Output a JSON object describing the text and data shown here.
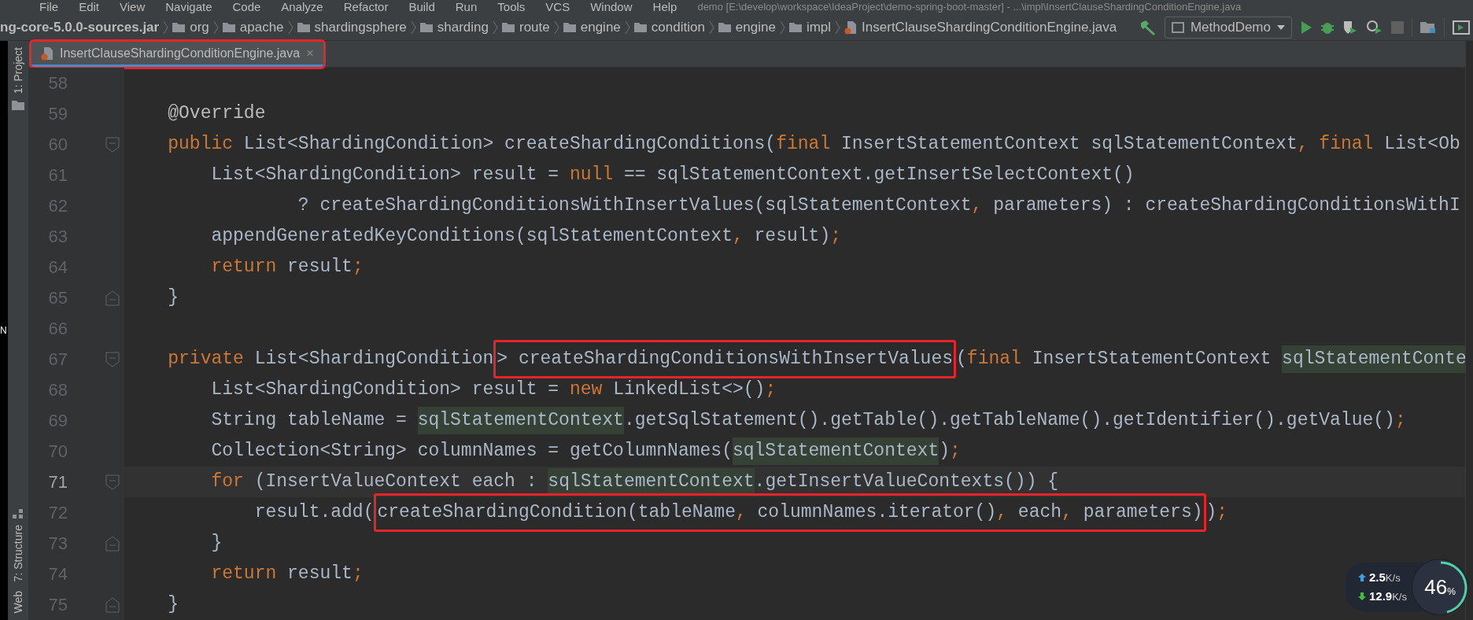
{
  "menu": [
    "File",
    "Edit",
    "View",
    "Navigate",
    "Code",
    "Analyze",
    "Refactor",
    "Build",
    "Run",
    "Tools",
    "VCS",
    "Window",
    "Help"
  ],
  "window": {
    "title": "demo [E:\\develop\\workspace\\IdeaProject\\demo-spring-boot-master] - ...\\impl\\InsertClauseShardingConditionEngine.java"
  },
  "breadcrumbs": [
    {
      "kind": "jar",
      "label": "ng-core-5.0.0-sources.jar"
    },
    {
      "kind": "folder",
      "label": "org"
    },
    {
      "kind": "folder",
      "label": "apache"
    },
    {
      "kind": "folder",
      "label": "shardingsphere"
    },
    {
      "kind": "folder",
      "label": "sharding"
    },
    {
      "kind": "folder",
      "label": "route"
    },
    {
      "kind": "folder",
      "label": "engine"
    },
    {
      "kind": "folder",
      "label": "condition"
    },
    {
      "kind": "folder",
      "label": "engine"
    },
    {
      "kind": "folder",
      "label": "impl"
    },
    {
      "kind": "file",
      "label": "InsertClauseShardingConditionEngine.java"
    }
  ],
  "run_config": "MethodDemo",
  "tabs": [
    {
      "label": "InsertClauseShardingConditionEngine.java",
      "close": "×",
      "selected": true,
      "marked": true
    }
  ],
  "side_panels": [
    {
      "kind": "top",
      "label": "1: Project"
    },
    {
      "kind": "bottom",
      "label": "7: Structure"
    },
    {
      "kind": "bottom",
      "label": "Web"
    }
  ],
  "edge_letter": "N",
  "lines": [
    {
      "number": "58",
      "current": false,
      "fold_start": false,
      "fold_end": false
    },
    {
      "number": "59",
      "current": false,
      "fold_start": false,
      "fold_end": false,
      "tokens": [
        {
          "text": "    @Override",
          "kind": "annotation"
        }
      ]
    },
    {
      "number": "60",
      "current": false,
      "fold_start": true,
      "fold_end": false,
      "tokens": [
        {
          "text": "    public",
          "kind": "keyword"
        },
        {
          "text": " List<ShardingCondition> createShardingConditions(",
          "kind": "plain"
        },
        {
          "text": "final",
          "kind": "keyword"
        },
        {
          "text": " InsertStatementContext sqlStatementContext",
          "kind": "plain"
        },
        {
          "text": ",",
          "kind": "keyword"
        },
        {
          "text": " final",
          "kind": "keyword"
        },
        {
          "text": " List<Ob",
          "kind": "plain"
        }
      ]
    },
    {
      "number": "61",
      "current": false,
      "fold_start": false,
      "fold_end": false,
      "tokens": [
        {
          "text": "        List<ShardingCondition> result = ",
          "kind": "plain"
        },
        {
          "text": "null",
          "kind": "keyword"
        },
        {
          "text": " == sqlStatementContext.getInsertSelectContext()",
          "kind": "plain"
        }
      ]
    },
    {
      "number": "62",
      "current": false,
      "fold_start": false,
      "fold_end": false,
      "tokens": [
        {
          "text": "                ? createShardingConditionsWithInsertValues(sqlStatementContext",
          "kind": "plain"
        },
        {
          "text": ",",
          "kind": "keyword"
        },
        {
          "text": " parameters) : createShardingConditionsWithI",
          "kind": "plain"
        }
      ]
    },
    {
      "number": "63",
      "current": false,
      "fold_start": false,
      "fold_end": false,
      "tokens": [
        {
          "text": "        appendGeneratedKeyConditions(sqlStatementContext",
          "kind": "plain"
        },
        {
          "text": ",",
          "kind": "keyword"
        },
        {
          "text": " result)",
          "kind": "plain"
        },
        {
          "text": ";",
          "kind": "keyword"
        }
      ]
    },
    {
      "number": "64",
      "current": false,
      "fold_start": false,
      "fold_end": false,
      "tokens": [
        {
          "text": "        return",
          "kind": "keyword"
        },
        {
          "text": " result",
          "kind": "plain"
        },
        {
          "text": ";",
          "kind": "keyword"
        }
      ]
    },
    {
      "number": "65",
      "current": false,
      "fold_start": false,
      "fold_end": true,
      "tokens": [
        {
          "text": "    }",
          "kind": "plain"
        }
      ]
    },
    {
      "number": "66",
      "current": false,
      "fold_start": false,
      "fold_end": false
    },
    {
      "number": "67",
      "current": false,
      "fold_start": true,
      "fold_end": false,
      "tokens": [
        {
          "text": "    private",
          "kind": "keyword"
        },
        {
          "text": " List<ShardingCondition",
          "kind": "plain"
        },
        {
          "kind": "box",
          "tokens": [
            {
              "text": "> createShardingConditionsWithInsertValues",
              "kind": "plain"
            }
          ]
        },
        {
          "text": "(",
          "kind": "plain"
        },
        {
          "text": "final",
          "kind": "keyword"
        },
        {
          "text": " InsertStatementContext ",
          "kind": "plain"
        },
        {
          "text": "sqlStatementConte",
          "kind": "usage"
        }
      ]
    },
    {
      "number": "68",
      "current": false,
      "fold_start": false,
      "fold_end": false,
      "tokens": [
        {
          "text": "        List<ShardingCondition> result = ",
          "kind": "plain"
        },
        {
          "text": "new",
          "kind": "keyword"
        },
        {
          "text": " LinkedList<>()",
          "kind": "plain"
        },
        {
          "text": ";",
          "kind": "keyword"
        }
      ]
    },
    {
      "number": "69",
      "current": false,
      "fold_start": false,
      "fold_end": false,
      "tokens": [
        {
          "text": "        String tableName = ",
          "kind": "plain"
        },
        {
          "text": "sqlStatementContext",
          "kind": "usage"
        },
        {
          "text": ".getSqlStatement().getTable().getTableName().getIdentifier().getValue()",
          "kind": "plain"
        },
        {
          "text": ";",
          "kind": "keyword"
        }
      ]
    },
    {
      "number": "70",
      "current": false,
      "fold_start": false,
      "fold_end": false,
      "tokens": [
        {
          "text": "        Collection<String> columnNames = getColumnNames(",
          "kind": "plain"
        },
        {
          "text": "sqlStatementContext",
          "kind": "usage"
        },
        {
          "text": ")",
          "kind": "plain"
        },
        {
          "text": ";",
          "kind": "keyword"
        }
      ]
    },
    {
      "number": "71",
      "current": true,
      "fold_start": true,
      "fold_end": false,
      "tokens": [
        {
          "text": "        for",
          "kind": "keyword"
        },
        {
          "text": " (InsertValueContext each : ",
          "kind": "plain"
        },
        {
          "text": "sqlStatementContext",
          "kind": "usage"
        },
        {
          "text": ".getInsertValueContexts()) {",
          "kind": "plain"
        }
      ]
    },
    {
      "number": "72",
      "current": false,
      "fold_start": false,
      "fold_end": false,
      "tokens": [
        {
          "text": "            result.add(",
          "kind": "plain"
        },
        {
          "kind": "box",
          "tokens": [
            {
              "text": "createShardingCondition(tableName",
              "kind": "plain"
            },
            {
              "text": ",",
              "kind": "keyword"
            },
            {
              "text": " columnNames.iterator()",
              "kind": "plain"
            },
            {
              "text": ",",
              "kind": "keyword"
            },
            {
              "text": " each",
              "kind": "plain"
            },
            {
              "text": ",",
              "kind": "keyword"
            },
            {
              "text": " parameters)",
              "kind": "plain"
            }
          ]
        },
        {
          "text": ")",
          "kind": "plain"
        },
        {
          "text": ";",
          "kind": "keyword"
        }
      ]
    },
    {
      "number": "73",
      "current": false,
      "fold_start": false,
      "fold_end": true,
      "tokens": [
        {
          "text": "        }",
          "kind": "plain"
        }
      ]
    },
    {
      "number": "74",
      "current": false,
      "fold_start": false,
      "fold_end": false,
      "tokens": [
        {
          "text": "        return",
          "kind": "keyword"
        },
        {
          "text": " result",
          "kind": "plain"
        },
        {
          "text": ";",
          "kind": "keyword"
        }
      ]
    },
    {
      "number": "75",
      "current": false,
      "fold_start": false,
      "fold_end": true,
      "tokens": [
        {
          "text": "    }",
          "kind": "plain"
        }
      ]
    }
  ],
  "net_monitor": {
    "upload": {
      "value": "2.5",
      "unit": "K/s"
    },
    "download": {
      "value": "12.9",
      "unit": "K/s"
    },
    "gauge": {
      "value": "46",
      "unit": "%",
      "level": 0.46
    }
  }
}
